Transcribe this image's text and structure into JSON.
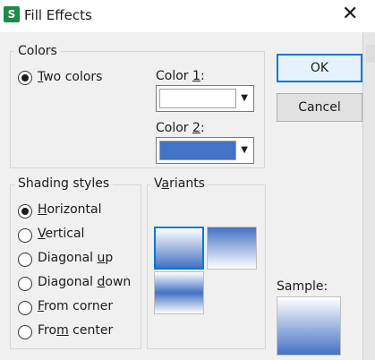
{
  "window": {
    "title": "Fill Effects",
    "app_icon_letter": "S"
  },
  "colors_group": {
    "label": "Colors",
    "option_pre": "",
    "option_u": "T",
    "option_post": "wo colors",
    "color1": {
      "pre": "Color ",
      "u": "1",
      "post": ":",
      "value_hex": "#ffffff"
    },
    "color2": {
      "pre": "Color ",
      "u": "2",
      "post": ":",
      "value_hex": "#4472c4"
    }
  },
  "buttons": {
    "ok": "OK",
    "cancel": "Cancel"
  },
  "shading": {
    "label": "Shading styles",
    "options": [
      {
        "pre": "",
        "u": "H",
        "post": "orizontal",
        "checked": true
      },
      {
        "pre": "",
        "u": "V",
        "post": "ertical",
        "checked": false
      },
      {
        "pre": "Diagonal ",
        "u": "u",
        "post": "p",
        "checked": false
      },
      {
        "pre": "Diagonal ",
        "u": "d",
        "post": "own",
        "checked": false
      },
      {
        "pre": "",
        "u": "F",
        "post": "rom corner",
        "checked": false
      },
      {
        "pre": "Fro",
        "u": "m",
        "post": " center",
        "checked": false
      }
    ]
  },
  "variants": {
    "pre": "V",
    "u": "a",
    "post": "riants"
  },
  "sample": {
    "label": "Sample:"
  },
  "colors": {
    "accent": "#4472c4",
    "focus": "#0078d7"
  },
  "icons": {
    "close": "close-icon",
    "dropdown": "chevron-down-icon"
  }
}
